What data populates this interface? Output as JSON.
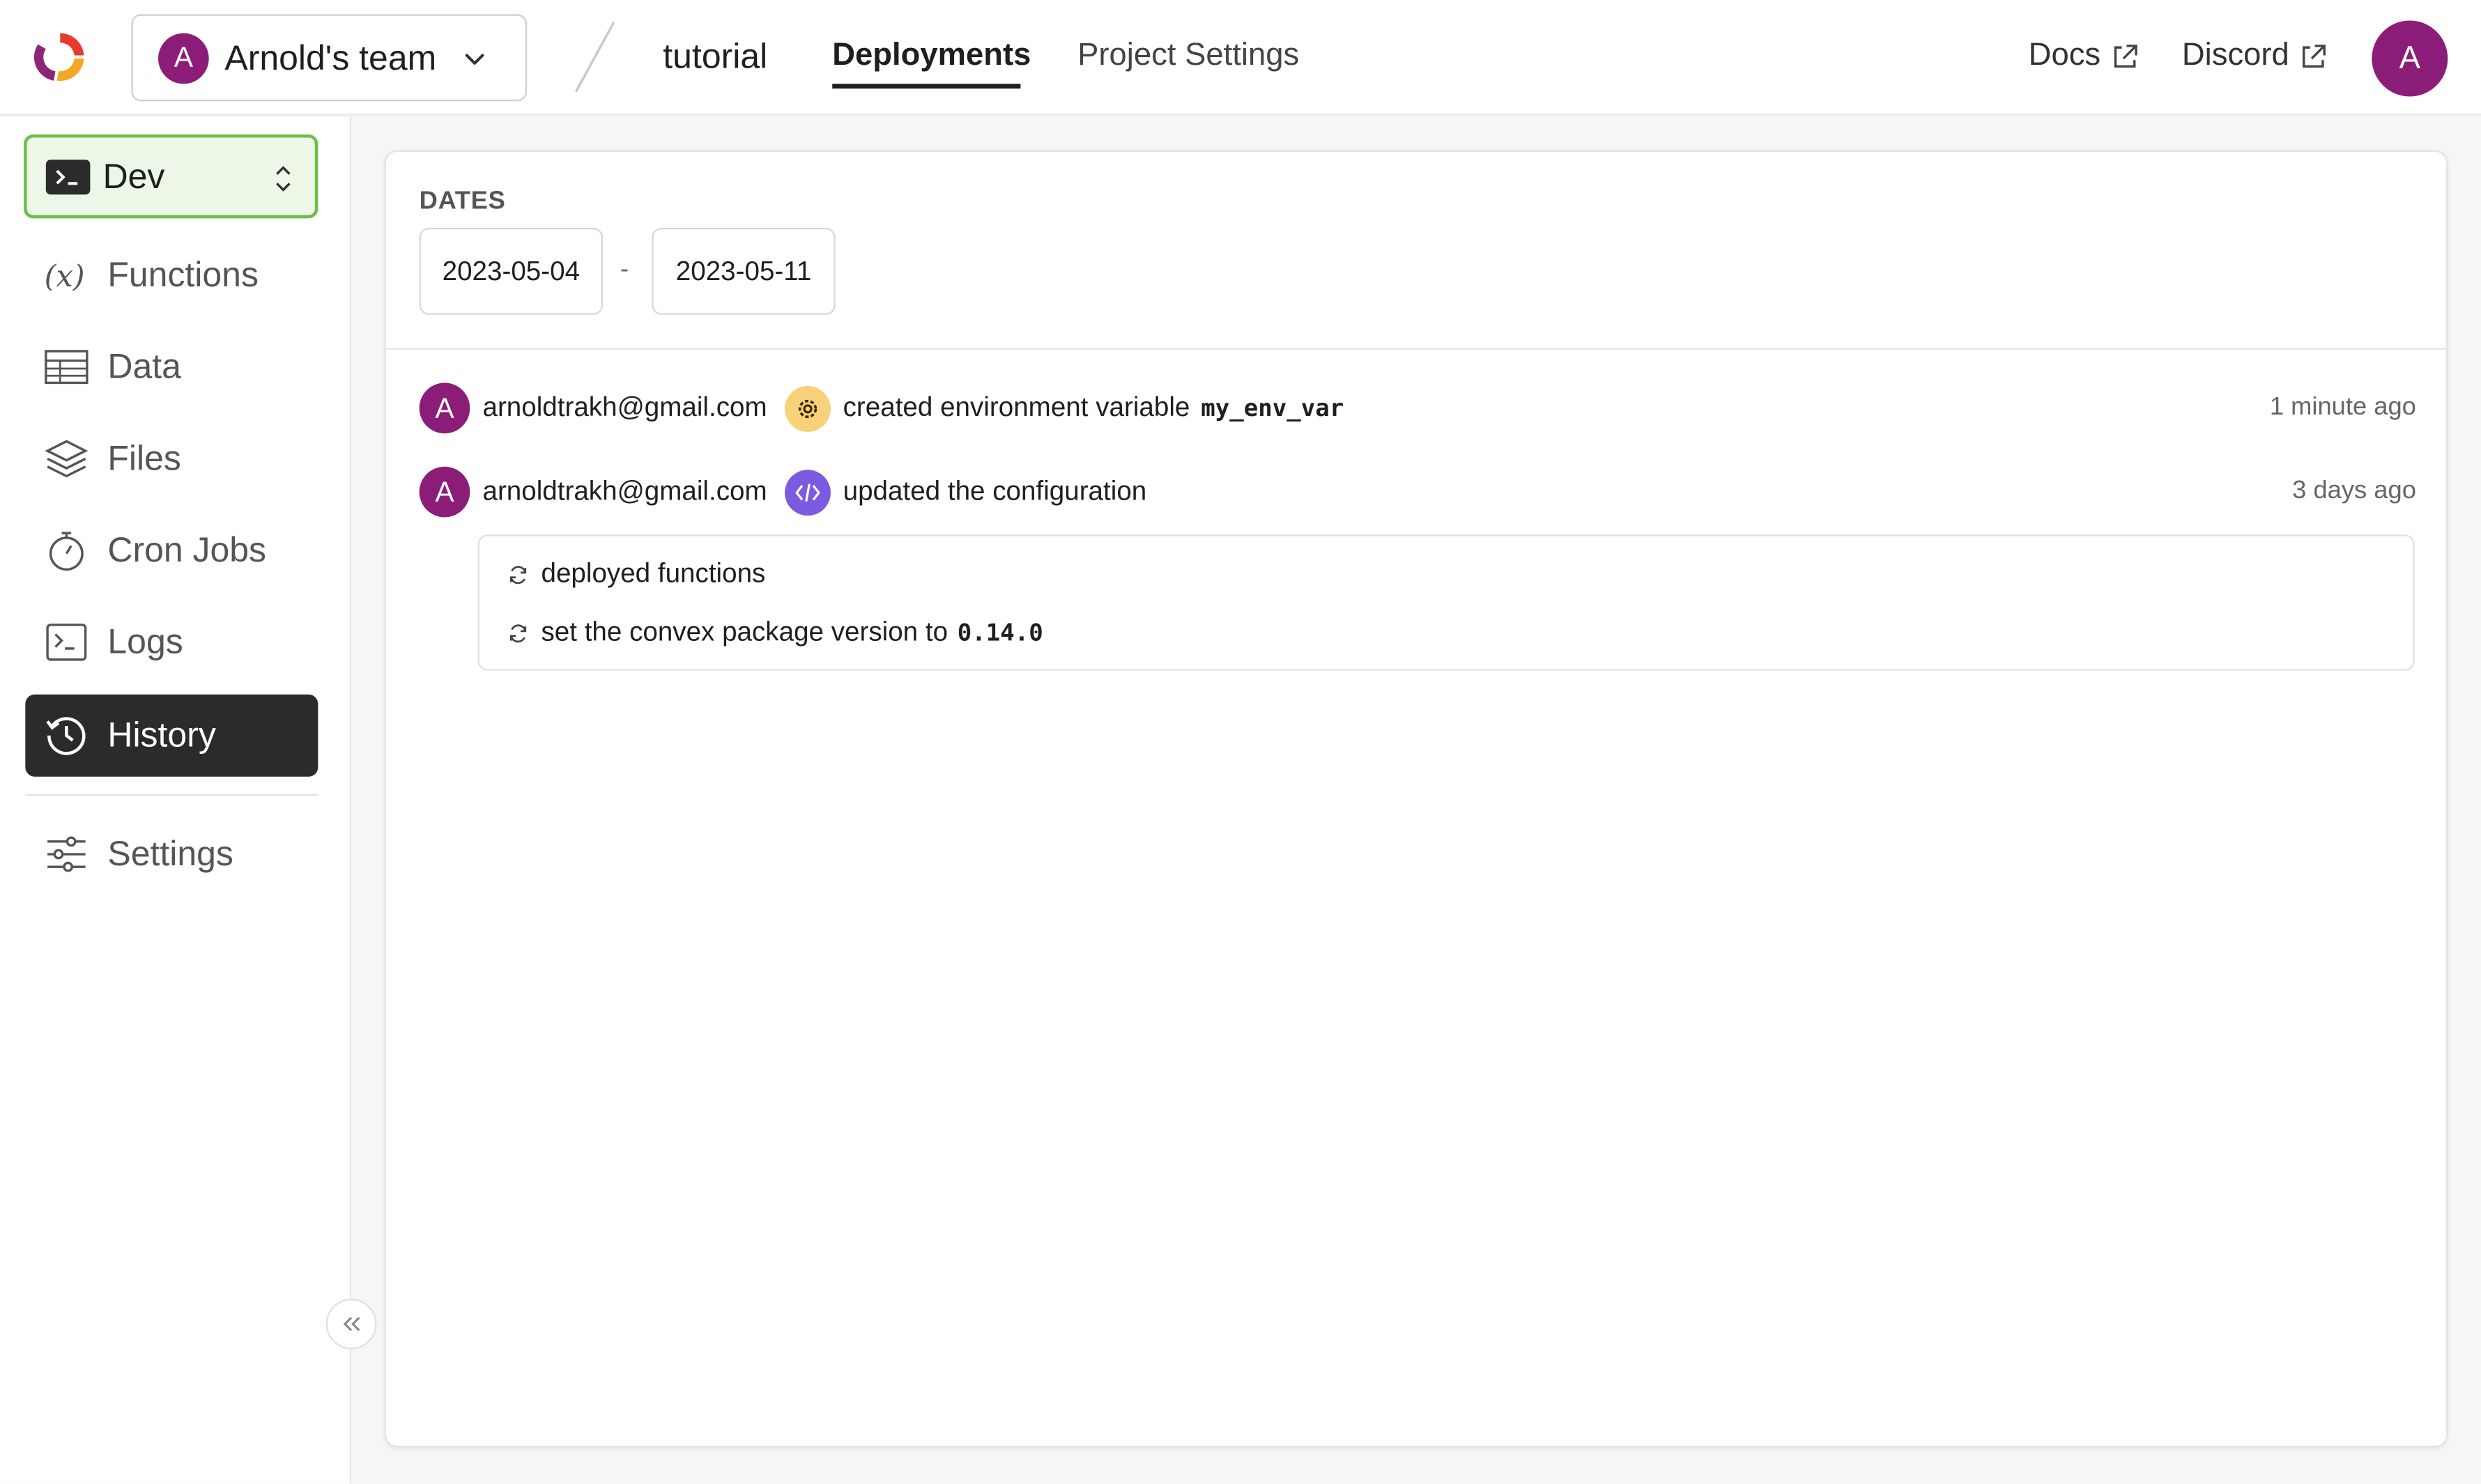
{
  "header": {
    "team": {
      "avatar_initial": "A",
      "name": "Arnold's team"
    },
    "project": "tutorial",
    "tabs": [
      {
        "label": "Deployments",
        "active": true
      },
      {
        "label": "Project Settings",
        "active": false
      }
    ],
    "links": {
      "docs": "Docs",
      "discord": "Discord"
    },
    "user_avatar_initial": "A"
  },
  "sidebar": {
    "environment": "Dev",
    "items": [
      {
        "label": "Functions",
        "icon": "function-icon"
      },
      {
        "label": "Data",
        "icon": "table-icon"
      },
      {
        "label": "Files",
        "icon": "layers-icon"
      },
      {
        "label": "Cron Jobs",
        "icon": "stopwatch-icon"
      },
      {
        "label": "Logs",
        "icon": "terminal-icon"
      },
      {
        "label": "History",
        "icon": "history-icon",
        "active": true
      },
      {
        "label": "Settings",
        "icon": "sliders-icon"
      }
    ]
  },
  "main": {
    "dates_label": "DATES",
    "date_start": "2023-05-04",
    "date_separator": "-",
    "date_end": "2023-05-11",
    "events": [
      {
        "avatar_initial": "A",
        "user": "arnoldtrakh@gmail.com",
        "icon": "gear-icon",
        "text": "created environment variable",
        "code": "my_env_var",
        "time": "1 minute ago"
      },
      {
        "avatar_initial": "A",
        "user": "arnoldtrakh@gmail.com",
        "icon": "code-icon",
        "text": "updated the configuration",
        "time": "3 days ago",
        "details": [
          {
            "text": "deployed functions"
          },
          {
            "text": "set the convex package version to",
            "code": "0.14.0"
          }
        ]
      }
    ]
  },
  "colors": {
    "avatar": "#8b1d79",
    "env_border": "#6cbf4a",
    "env_bg": "#edf7e8",
    "active_nav": "#2b2b2b",
    "gear_badge": "#f7d27a",
    "code_badge": "#7b5ce0"
  }
}
